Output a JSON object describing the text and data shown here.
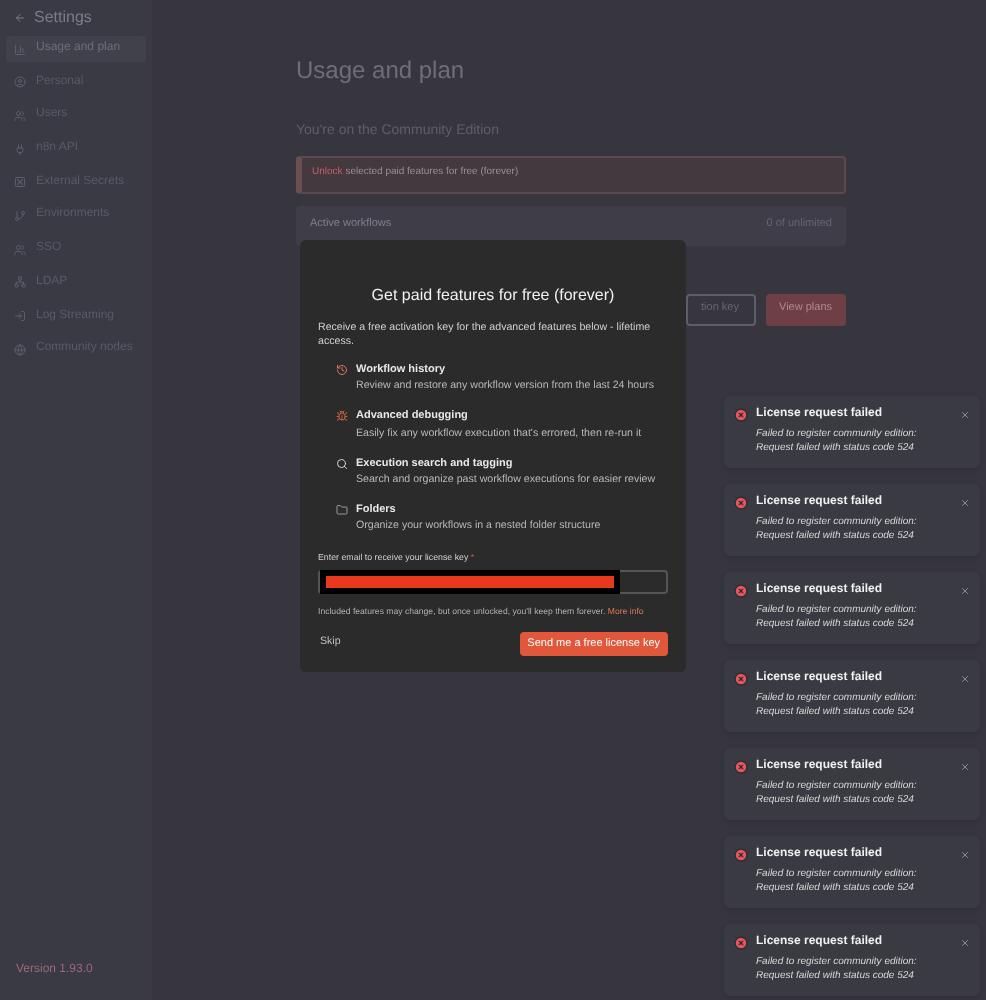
{
  "sidebar": {
    "title": "Settings",
    "items": [
      {
        "label": "Usage and plan",
        "selected": true
      },
      {
        "label": "Personal",
        "selected": false
      },
      {
        "label": "Users",
        "selected": false
      },
      {
        "label": "n8n API",
        "selected": false
      },
      {
        "label": "External Secrets",
        "selected": false
      },
      {
        "label": "Environments",
        "selected": false
      },
      {
        "label": "SSO",
        "selected": false
      },
      {
        "label": "LDAP",
        "selected": false
      },
      {
        "label": "Log Streaming",
        "selected": false
      },
      {
        "label": "Community nodes",
        "selected": false
      }
    ],
    "version": "Version 1.93.0"
  },
  "page": {
    "title": "Usage and plan",
    "subtitle": "You're on the Community Edition",
    "banner": {
      "link": "Unlock",
      "text": "selected paid features for free (forever)"
    },
    "usage": {
      "label": "Active workflows",
      "value": "0 of unlimited"
    },
    "buttons": [
      {
        "label": "tion key",
        "kind": "secondary"
      },
      {
        "label": "View plans",
        "kind": "primary"
      }
    ]
  },
  "modal": {
    "title": "Get paid features for free (forever)",
    "intro": "Receive a free activation key for the advanced features below - lifetime access.",
    "features": [
      {
        "title": "Workflow history",
        "description": "Review and restore any workflow version from the last 24 hours"
      },
      {
        "title": "Advanced debugging",
        "description": "Easily fix any workflow execution that's errored, then re-run it"
      },
      {
        "title": "Execution search and tagging",
        "description": "Search and organize past workflow executions for easier review"
      },
      {
        "title": "Folders",
        "description": "Organize your workflows in a nested folder structure"
      }
    ],
    "email_label": "Enter email to receive your license key",
    "required_mark": "*",
    "note": "Included features may change, but once unlocked, you'll keep them forever.",
    "note_link": "More info",
    "skip": "Skip",
    "submit": "Send me a free license key"
  },
  "toasts": [
    {
      "title": "License request failed",
      "message": "Failed to register community edition: Request failed with status code 524"
    },
    {
      "title": "License request failed",
      "message": "Failed to register community edition: Request failed with status code 524"
    },
    {
      "title": "License request failed",
      "message": "Failed to register community edition: Request failed with status code 524"
    },
    {
      "title": "License request failed",
      "message": "Failed to register community edition: Request failed with status code 524"
    },
    {
      "title": "License request failed",
      "message": "Failed to register community edition: Request failed with status code 524"
    },
    {
      "title": "License request failed",
      "message": "Failed to register community edition: Request failed with status code 524"
    },
    {
      "title": "License request failed",
      "message": "Failed to register community edition: Request failed with status code 524"
    }
  ]
}
